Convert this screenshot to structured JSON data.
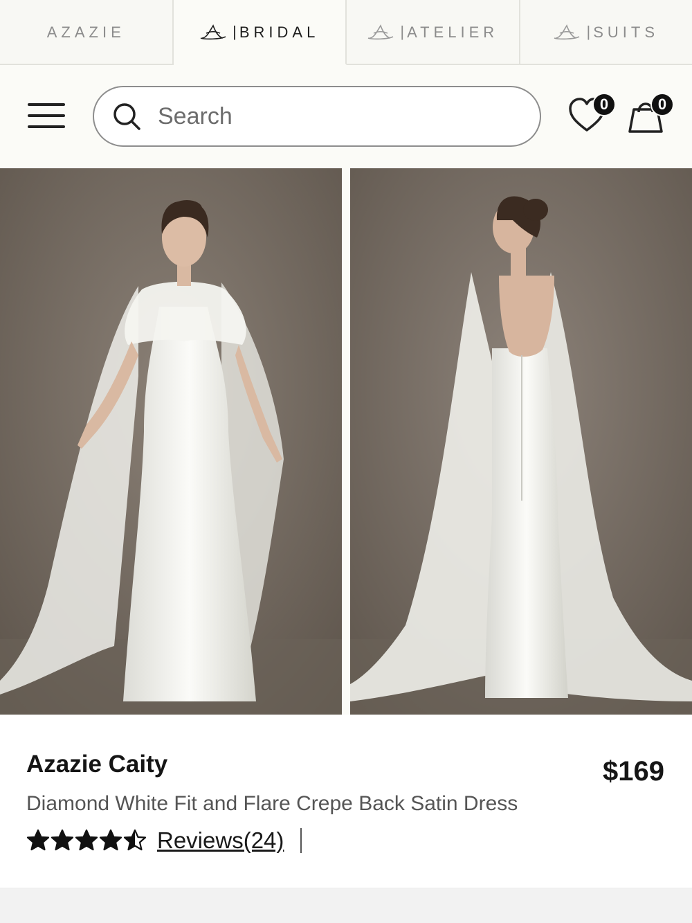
{
  "brand_tabs": [
    {
      "label": "AZAZIE",
      "active": false,
      "logo": false
    },
    {
      "label": "BRIDAL",
      "active": true,
      "logo": true
    },
    {
      "label": "ATELIER",
      "active": false,
      "logo": true
    },
    {
      "label": "SUITS",
      "active": false,
      "logo": true
    }
  ],
  "header": {
    "menu_icon": "hamburger-menu-icon",
    "search_placeholder": "Search",
    "wishlist_count": "0",
    "cart_count": "0"
  },
  "product": {
    "name": "Azazie Caity",
    "price": "$169",
    "description": "Diamond White Fit and Flare Crepe Back Satin Dress",
    "rating": 4.5,
    "reviews_label": "Reviews(24)",
    "images": [
      "front-view",
      "back-view"
    ]
  },
  "colors": {
    "background": "#fbfbf7",
    "photo_backdrop": "#7a7066",
    "text": "#151515"
  }
}
